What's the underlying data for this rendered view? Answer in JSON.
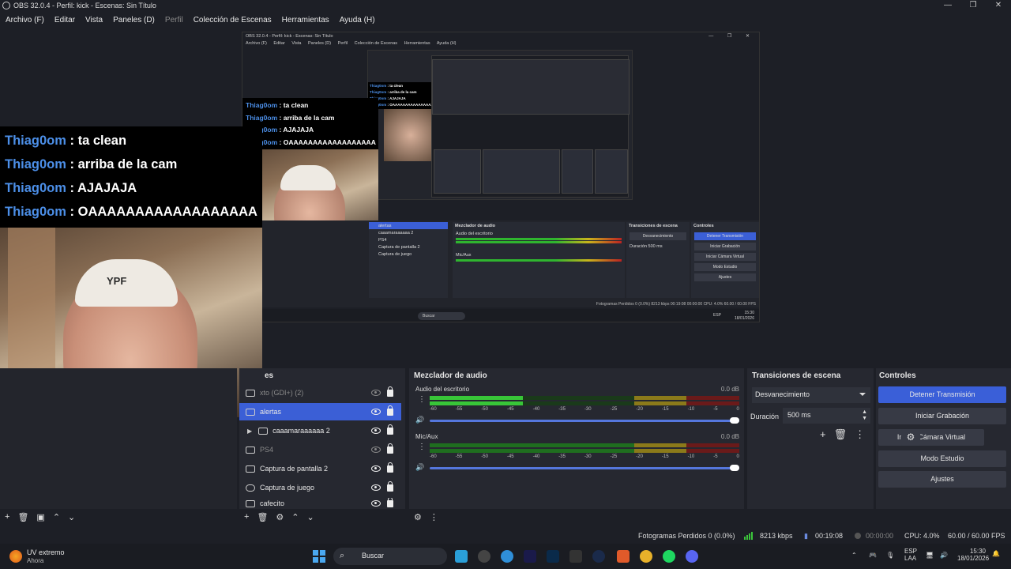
{
  "window": {
    "title": "OBS 32.0.4 - Perfil: kick - Escenas: Sin Título",
    "controls": [
      "—",
      "❐",
      "✕"
    ]
  },
  "menu": {
    "items": [
      "Archivo (F)",
      "Editar",
      "Vista",
      "Paneles (D)",
      "Perfil",
      "Colección de Escenas",
      "Herramientas",
      "Ayuda (H)"
    ]
  },
  "chat": {
    "messages": [
      {
        "user": "Thiag0om",
        "text": ": ta clean"
      },
      {
        "user": "Thiag0om",
        "text": ": arriba de la cam"
      },
      {
        "user": "Thiag0om",
        "text": ": AJAJAJA"
      },
      {
        "user": "Thiag0om",
        "text": ": OAAAAAAAAAAAAAAAAAA"
      }
    ],
    "mid_messages": [
      {
        "user": "Thiag0om",
        "text": ": ta clean"
      },
      {
        "user": "Thiag0om",
        "text": ": arriba de la cam"
      },
      {
        "user": "Thiag0om",
        "text": ": AJAJAJA"
      },
      {
        "user": "Thiag0om",
        "text": ": OAAAAAAAAAAAAAAAAAA"
      }
    ],
    "small_messages": [
      {
        "user": "Thiag0om",
        "text": ": ta clean"
      },
      {
        "user": "Thiag0om",
        "text": ": arriba de la cam"
      },
      {
        "user": "Thiag0om",
        "text": ": AJAJAJA"
      },
      {
        "user": "Thiag0om",
        "text": ": OAAAAAAAAAAAAAAAAAA"
      }
    ]
  },
  "camera": {
    "cap_brand": "YPF"
  },
  "nested": {
    "title": "OBS 32.0.4 - Perfil: kick - Escenas: Sin Título",
    "menu": [
      "Archivo (F)",
      "Editar",
      "Vista",
      "Paneles (D)",
      "Perfil",
      "Colección de Escenas",
      "Herramientas",
      "Ayuda (H)"
    ],
    "mixer_title": "Mezclador de audio",
    "transitions_title": "Transiciones de escena",
    "controls_title": "Controles",
    "sources": [
      "alertas",
      "caaamaraaaaaa 2",
      "PS4",
      "Captura de pantalla 2",
      "Captura de juego"
    ],
    "tracks": [
      "Audio del escritorio",
      "Mic/Aux"
    ],
    "transition": "Desvanecimiento",
    "duration_label": "Duración",
    "duration": "500 ms",
    "buttons": [
      "Detener Transmisión",
      "Iniciar Grabación",
      "Iniciar Cámara Virtual",
      "Modo Estudio",
      "Ajustes"
    ],
    "status": "Fotogramas Perdidos 0 (0.0%)   8213 kbps   00:19:08   00:00:00   CPU: 4.0%   60.00 / 60.00 FPS",
    "search": "Buscar",
    "tray_lang": "ESP",
    "tray_time": "15:30",
    "tray_date": "18/01/2026"
  },
  "sources": {
    "title": "es",
    "items": [
      {
        "label": "xto (GDI+) (2)",
        "visible": false,
        "dim": true,
        "selected": false
      },
      {
        "label": "alertas",
        "visible": true,
        "dim": false,
        "selected": true
      },
      {
        "label": "caaamaraaaaaa 2",
        "visible": true,
        "dim": false,
        "selected": false
      },
      {
        "label": "PS4",
        "visible": false,
        "dim": true,
        "selected": false
      },
      {
        "label": "Captura de pantalla 2",
        "visible": true,
        "dim": false,
        "selected": false
      },
      {
        "label": "Captura de juego",
        "visible": true,
        "dim": false,
        "selected": false
      },
      {
        "label": "cafecito",
        "visible": true,
        "dim": false,
        "selected": false
      }
    ]
  },
  "mixer": {
    "title": "Mezclador de audio",
    "ticks": [
      "-60",
      "-55",
      "-50",
      "-45",
      "-40",
      "-35",
      "-30",
      "-25",
      "-20",
      "-15",
      "-10",
      "-5",
      "0"
    ],
    "tracks": [
      {
        "name": "Audio del escritorio",
        "db": "0.0 dB",
        "level": 0.3,
        "volume": 1.0
      },
      {
        "name": "Mic/Aux",
        "db": "0.0 dB",
        "level": 0.0,
        "volume": 1.0
      }
    ]
  },
  "transitions": {
    "title": "Transiciones de escena",
    "selected": "Desvanecimiento",
    "duration_label": "Duración",
    "duration": "500 ms"
  },
  "controls": {
    "title": "Controles",
    "buttons": [
      "Detener Transmisión",
      "Iniciar Grabación",
      "Iniciar Cámara Virtual",
      "Modo Estudio",
      "Ajustes"
    ]
  },
  "status": {
    "dropped": "Fotogramas Perdidos 0 (0.0%)",
    "bitrate": "8213 kbps",
    "stream_time": "00:19:08",
    "rec_time": "00:00:00",
    "cpu": "CPU: 4.0%",
    "fps": "60.00 / 60.00 FPS"
  },
  "taskbar": {
    "weather_title": "UV extremo",
    "weather_sub": "Ahora",
    "search": "Buscar",
    "lang_top": "ESP",
    "lang_bottom": "LAA",
    "time": "15:30",
    "date": "18/01/2026"
  },
  "colors": {
    "accent": "#3a5fd8",
    "meter_green": "#38c638",
    "username": "#4c8fe8"
  }
}
